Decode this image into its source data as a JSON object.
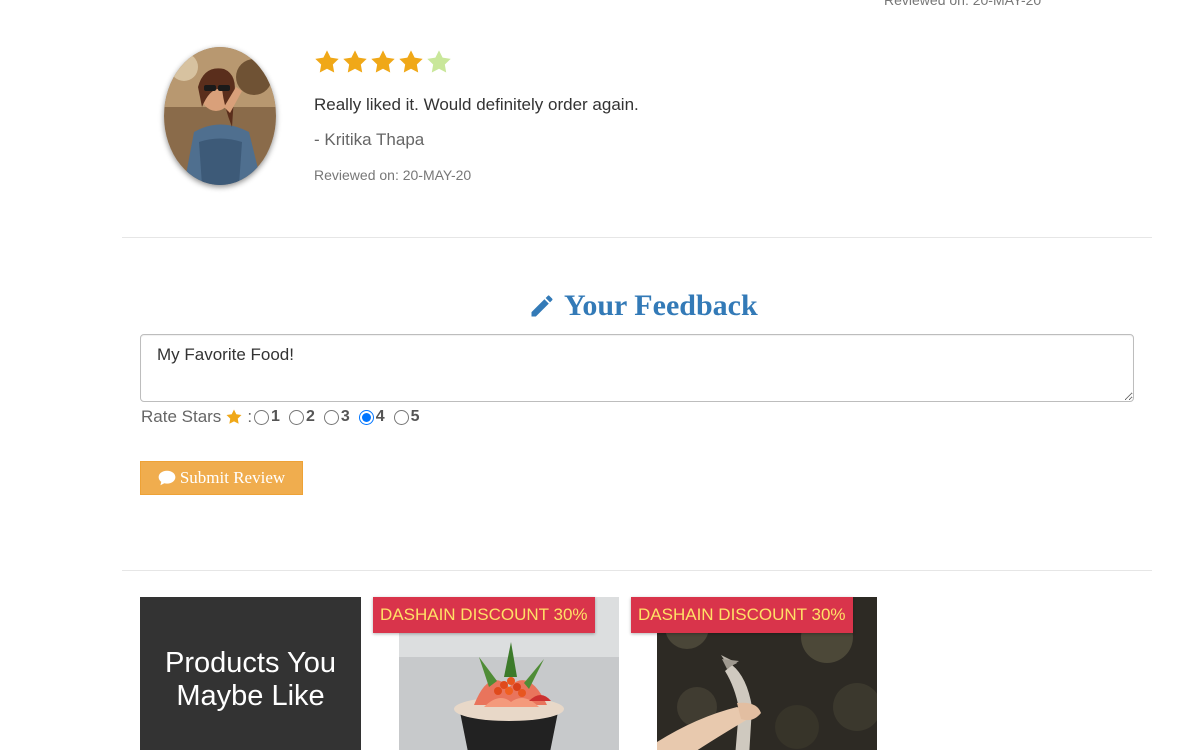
{
  "previous_review": {
    "date_text": "Reviewed on: 20-MAY-20"
  },
  "review": {
    "rating": 4,
    "max_rating": 5,
    "text": "Really liked it. Would definitely order again.",
    "author": "- Kritika Thapa",
    "date_text": "Reviewed on: 20-MAY-20",
    "star_filled_color": "#f0a818",
    "star_empty_color": "#c9e79a"
  },
  "feedback": {
    "title": "Your Feedback",
    "title_icon": "pencil-icon",
    "textarea_value": "My Favorite Food!",
    "rate_label": "Rate Stars",
    "rate_separator": ":",
    "rate_options": [
      "1",
      "2",
      "3",
      "4",
      "5"
    ],
    "selected_rating": "4",
    "submit_label": "Submit Review",
    "submit_icon": "comment-icon",
    "accent_color": "#337ab7",
    "button_color": "#f0ad4e"
  },
  "products": {
    "heading": "Products You Maybe Like",
    "items": [
      {
        "badge": "DASHAIN DISCOUNT 30%",
        "image": "sushi-bowl"
      },
      {
        "badge": "DASHAIN DISCOUNT 30%",
        "image": "hand-holding-fish"
      }
    ],
    "badge_color": "#d9344b",
    "badge_text_color": "#ffe066"
  }
}
